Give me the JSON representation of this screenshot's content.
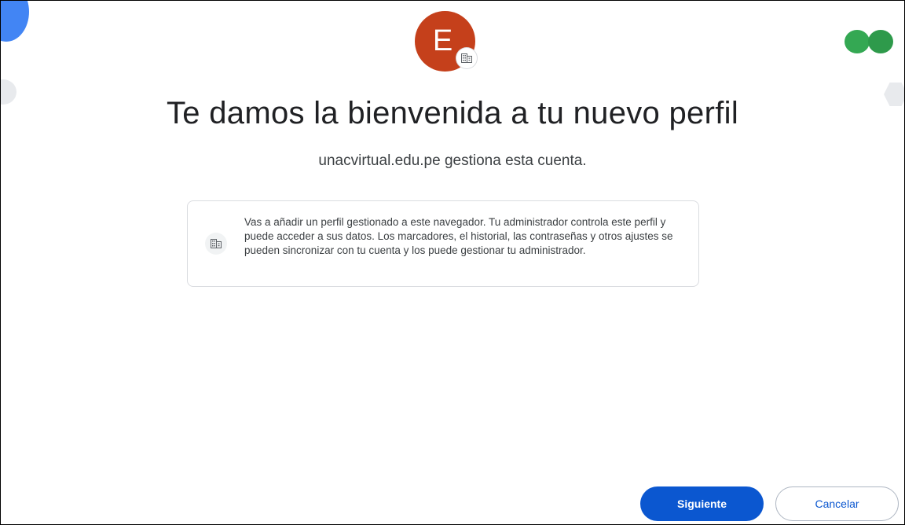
{
  "avatar": {
    "initial": "E",
    "color": "#c5401b",
    "badge_icon": "business-building-icon"
  },
  "header": {
    "title": "Te damos la bienvenida a tu nuevo perfil",
    "subtitle": "unacvirtual.edu.pe gestiona esta cuenta."
  },
  "info_card": {
    "icon": "business-building-icon",
    "text": "Vas a añadir un perfil gestionado a este navegador. Tu administrador controla este perfil y puede acceder a sus datos. Los marcadores, el historial, las contraseñas y otros ajustes se pueden sincronizar con tu cuenta y los puede gestionar tu administrador."
  },
  "actions": {
    "next_label": "Siguiente",
    "cancel_label": "Cancelar"
  },
  "colors": {
    "primary": "#0b57d0",
    "deco_blue": "#4285f4",
    "deco_green": "#34a853",
    "deco_grey": "#e8eaed"
  }
}
